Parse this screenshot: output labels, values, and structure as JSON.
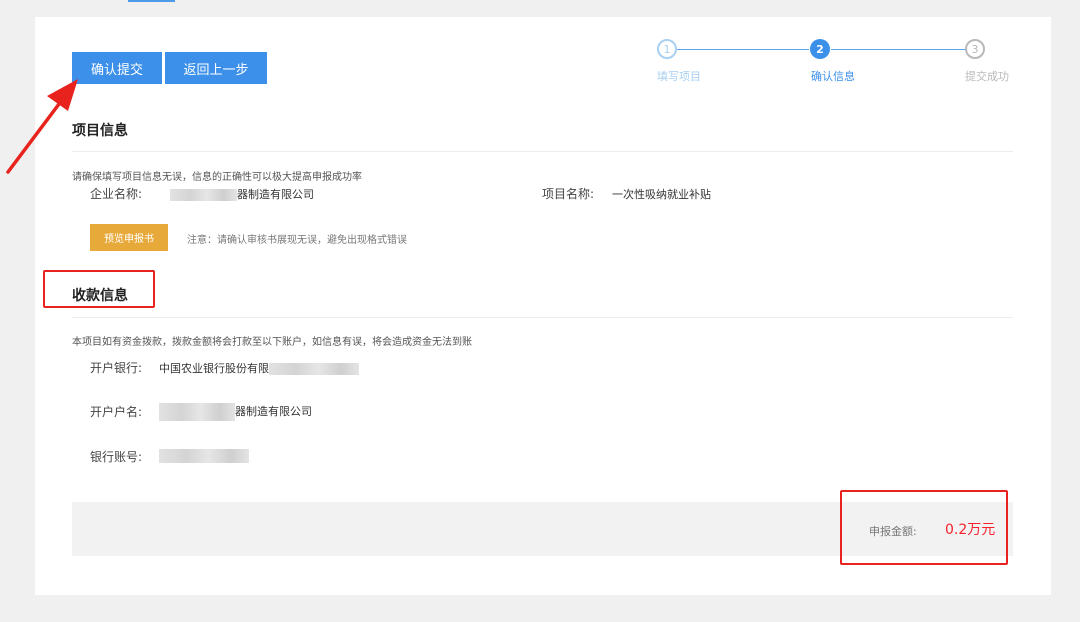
{
  "accent_color": "#3c90ea",
  "stepper": {
    "steps": [
      {
        "number": "1",
        "label": "填写项目",
        "state": "done"
      },
      {
        "number": "2",
        "label": "确认信息",
        "state": "active"
      },
      {
        "number": "3",
        "label": "提交成功",
        "state": "pending"
      }
    ]
  },
  "actions": {
    "confirm_label": "确认提交",
    "back_label": "返回上一步"
  },
  "project_info": {
    "title": "项目信息",
    "hint": "请确保填写项目信息无误，信息的正确性可以极大提高申报成功率",
    "company_label": "企业名称:",
    "company_value_suffix": "器制造有限公司",
    "project_label": "项目名称:",
    "project_value": "一次性吸纳就业补贴",
    "preview_button": "预览申报书",
    "note": "注意：请确认审核书展现无误，避免出现格式错误"
  },
  "payment_info": {
    "title": "收款信息",
    "hint": "本项目如有资金拨款，拨款金额将会打款至以下账户，如信息有误，将会造成资金无法到账",
    "bank_label": "开户银行:",
    "bank_value": "中国农业银行股份有限",
    "account_name_label": "开户户名:",
    "account_name_suffix": "器制造有限公司",
    "account_no_label": "银行账号:"
  },
  "amount": {
    "label": "申报金额:",
    "value": "0.2万元",
    "color": "#f5222d"
  }
}
